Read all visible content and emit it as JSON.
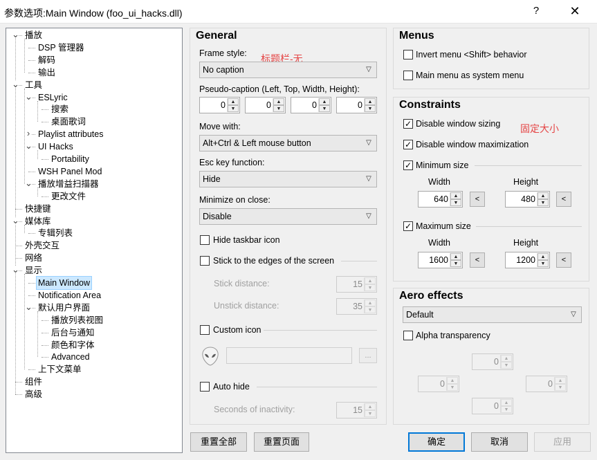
{
  "window": {
    "title": "参数选项:Main Window (foo_ui_hacks.dll)",
    "help": "?",
    "close": "✕"
  },
  "tree": [
    {
      "label": "播放",
      "indent": 0,
      "exp": "v"
    },
    {
      "label": "DSP 管理器",
      "indent": 1
    },
    {
      "label": "解码",
      "indent": 1
    },
    {
      "label": "输出",
      "indent": 1
    },
    {
      "label": "工具",
      "indent": 0,
      "exp": "v"
    },
    {
      "label": "ESLyric",
      "indent": 1,
      "exp": "v"
    },
    {
      "label": "搜索",
      "indent": 2
    },
    {
      "label": "桌面歌词",
      "indent": 2
    },
    {
      "label": "Playlist attributes",
      "indent": 1,
      "exp": ">"
    },
    {
      "label": "UI Hacks",
      "indent": 1,
      "exp": "v"
    },
    {
      "label": "Portability",
      "indent": 2
    },
    {
      "label": "WSH Panel Mod",
      "indent": 1
    },
    {
      "label": "播放增益扫描器",
      "indent": 1,
      "exp": "v"
    },
    {
      "label": "更改文件",
      "indent": 2
    },
    {
      "label": "快捷键",
      "indent": 0
    },
    {
      "label": "媒体库",
      "indent": 0,
      "exp": "v"
    },
    {
      "label": "专辑列表",
      "indent": 1
    },
    {
      "label": "外壳交互",
      "indent": 0
    },
    {
      "label": "网络",
      "indent": 0
    },
    {
      "label": "显示",
      "indent": 0,
      "exp": "v"
    },
    {
      "label": "Main Window",
      "indent": 1,
      "selected": true
    },
    {
      "label": "Notification Area",
      "indent": 1
    },
    {
      "label": "默认用户界面",
      "indent": 1,
      "exp": "v"
    },
    {
      "label": "播放列表视图",
      "indent": 2
    },
    {
      "label": "后台与通知",
      "indent": 2
    },
    {
      "label": "颜色和字体",
      "indent": 2
    },
    {
      "label": "Advanced",
      "indent": 2
    },
    {
      "label": "上下文菜单",
      "indent": 1
    },
    {
      "label": "组件",
      "indent": 0
    },
    {
      "label": "高级",
      "indent": 0
    }
  ],
  "general": {
    "title": "General",
    "frame_style_label": "Frame style:",
    "frame_style_value": "No caption",
    "frame_style_note": "标题栏-无",
    "pseudo_label": "Pseudo-caption (Left, Top, Width, Height):",
    "pseudo_values": [
      "0",
      "0",
      "0",
      "0"
    ],
    "move_label": "Move with:",
    "move_value": "Alt+Ctrl & Left mouse button",
    "esc_label": "Esc key function:",
    "esc_value": "Hide",
    "minimize_label": "Minimize on close:",
    "minimize_value": "Disable",
    "hide_taskbar": "Hide taskbar icon",
    "stick_edges": "Stick to the edges of the screen",
    "stick_distance_label": "Stick distance:",
    "stick_distance": "15",
    "unstick_distance_label": "Unstick distance:",
    "unstick_distance": "35",
    "custom_icon": "Custom icon",
    "icon_browse": "...",
    "auto_hide": "Auto hide",
    "inactivity_label": "Seconds of inactivity:",
    "inactivity": "15"
  },
  "menus": {
    "title": "Menus",
    "invert": "Invert menu <Shift> behavior",
    "system": "Main menu as system menu"
  },
  "constraints": {
    "title": "Constraints",
    "note": "固定大小",
    "disable_sizing": "Disable window sizing",
    "disable_max": "Disable window maximization",
    "min_size": "Minimum size",
    "max_size": "Maximum size",
    "width": "Width",
    "height": "Height",
    "min_w": "640",
    "min_h": "480",
    "max_w": "1600",
    "max_h": "1200",
    "pick": "<"
  },
  "aero": {
    "title": "Aero effects",
    "mode": "Default",
    "alpha": "Alpha transparency",
    "top": "0",
    "left": "0",
    "right": "0",
    "bottom": "0"
  },
  "buttons": {
    "reset_all": "重置全部",
    "reset_page": "重置页面",
    "ok": "确定",
    "cancel": "取消",
    "apply": "应用"
  }
}
